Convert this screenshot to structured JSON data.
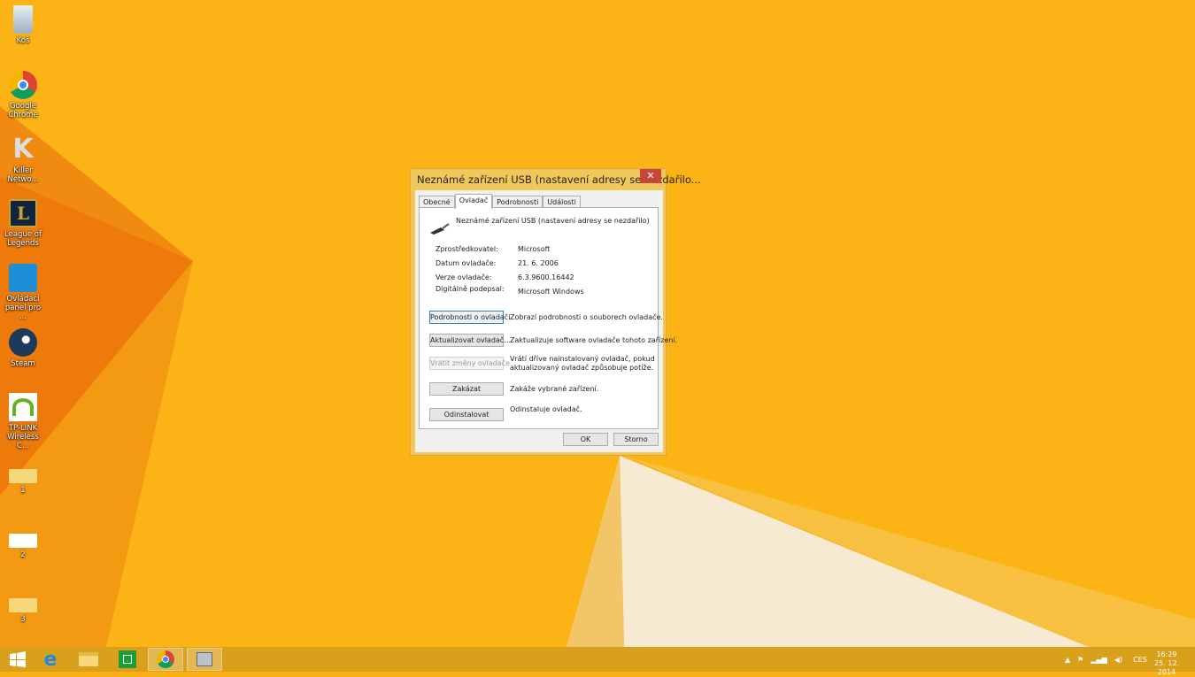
{
  "desktop": {
    "icons": [
      {
        "label": "Koš",
        "icon": "recycle-bin-icon"
      },
      {
        "label": "Google Chrome",
        "icon": "chrome-icon"
      },
      {
        "label": "Killer Netwo...",
        "icon": "killer-network-icon"
      },
      {
        "label": "League of Legends",
        "icon": "league-of-legends-icon"
      },
      {
        "label": "Ovládací panel pro ...",
        "icon": "intel-control-panel-icon"
      },
      {
        "label": "Steam",
        "icon": "steam-icon"
      },
      {
        "label": "TP-LINK Wireless C...",
        "icon": "tp-link-icon"
      },
      {
        "label": "1",
        "icon": "folder-icon"
      },
      {
        "label": "2",
        "icon": "file-icon"
      },
      {
        "label": "3",
        "icon": "folder-icon"
      }
    ]
  },
  "dialog": {
    "title": "Neznámé zařízení USB (nastavení adresy se nezdařilo...",
    "close": "✕",
    "tabs": [
      "Obecné",
      "Ovladač",
      "Podrobnosti",
      "Události"
    ],
    "active_tab": "Ovladač",
    "device_name": "Neznámé zařízení USB (nastavení adresy se nezdařilo)",
    "props": [
      {
        "label": "Zprostředkovatel:",
        "value": "Microsoft"
      },
      {
        "label": "Datum ovladače:",
        "value": "21. 6. 2006"
      },
      {
        "label": "Verze ovladače:",
        "value": "6.3.9600.16442"
      },
      {
        "label": "Digitálně podepsal:",
        "value": "Microsoft Windows"
      }
    ],
    "actions": [
      {
        "button": "Podrobnosti o ovladači",
        "desc": "Zobrazí podrobnosti o souborech ovladače."
      },
      {
        "button": "Aktualizovat ovladač...",
        "desc": "Zaktualizuje software ovladače tohoto zařízení."
      },
      {
        "button": "Vrátit změny ovladače",
        "desc": "Vrátí dříve nainstalovaný ovladač, pokud",
        "desc2": "aktualizovaný ovladač způsobuje potíže."
      },
      {
        "button": "Zakázat",
        "desc": "Zakáže vybrané zařízení."
      },
      {
        "button": "Odinstalovat",
        "desc": "Odinstaluje ovladač."
      }
    ],
    "ok": "OK",
    "cancel": "Storno"
  },
  "taskbar": {
    "lang": "CES",
    "time": "16:29",
    "date": "25. 12. 2014"
  },
  "colors": {
    "accent": "#FBB016",
    "taskbar": "#D6A01C"
  }
}
